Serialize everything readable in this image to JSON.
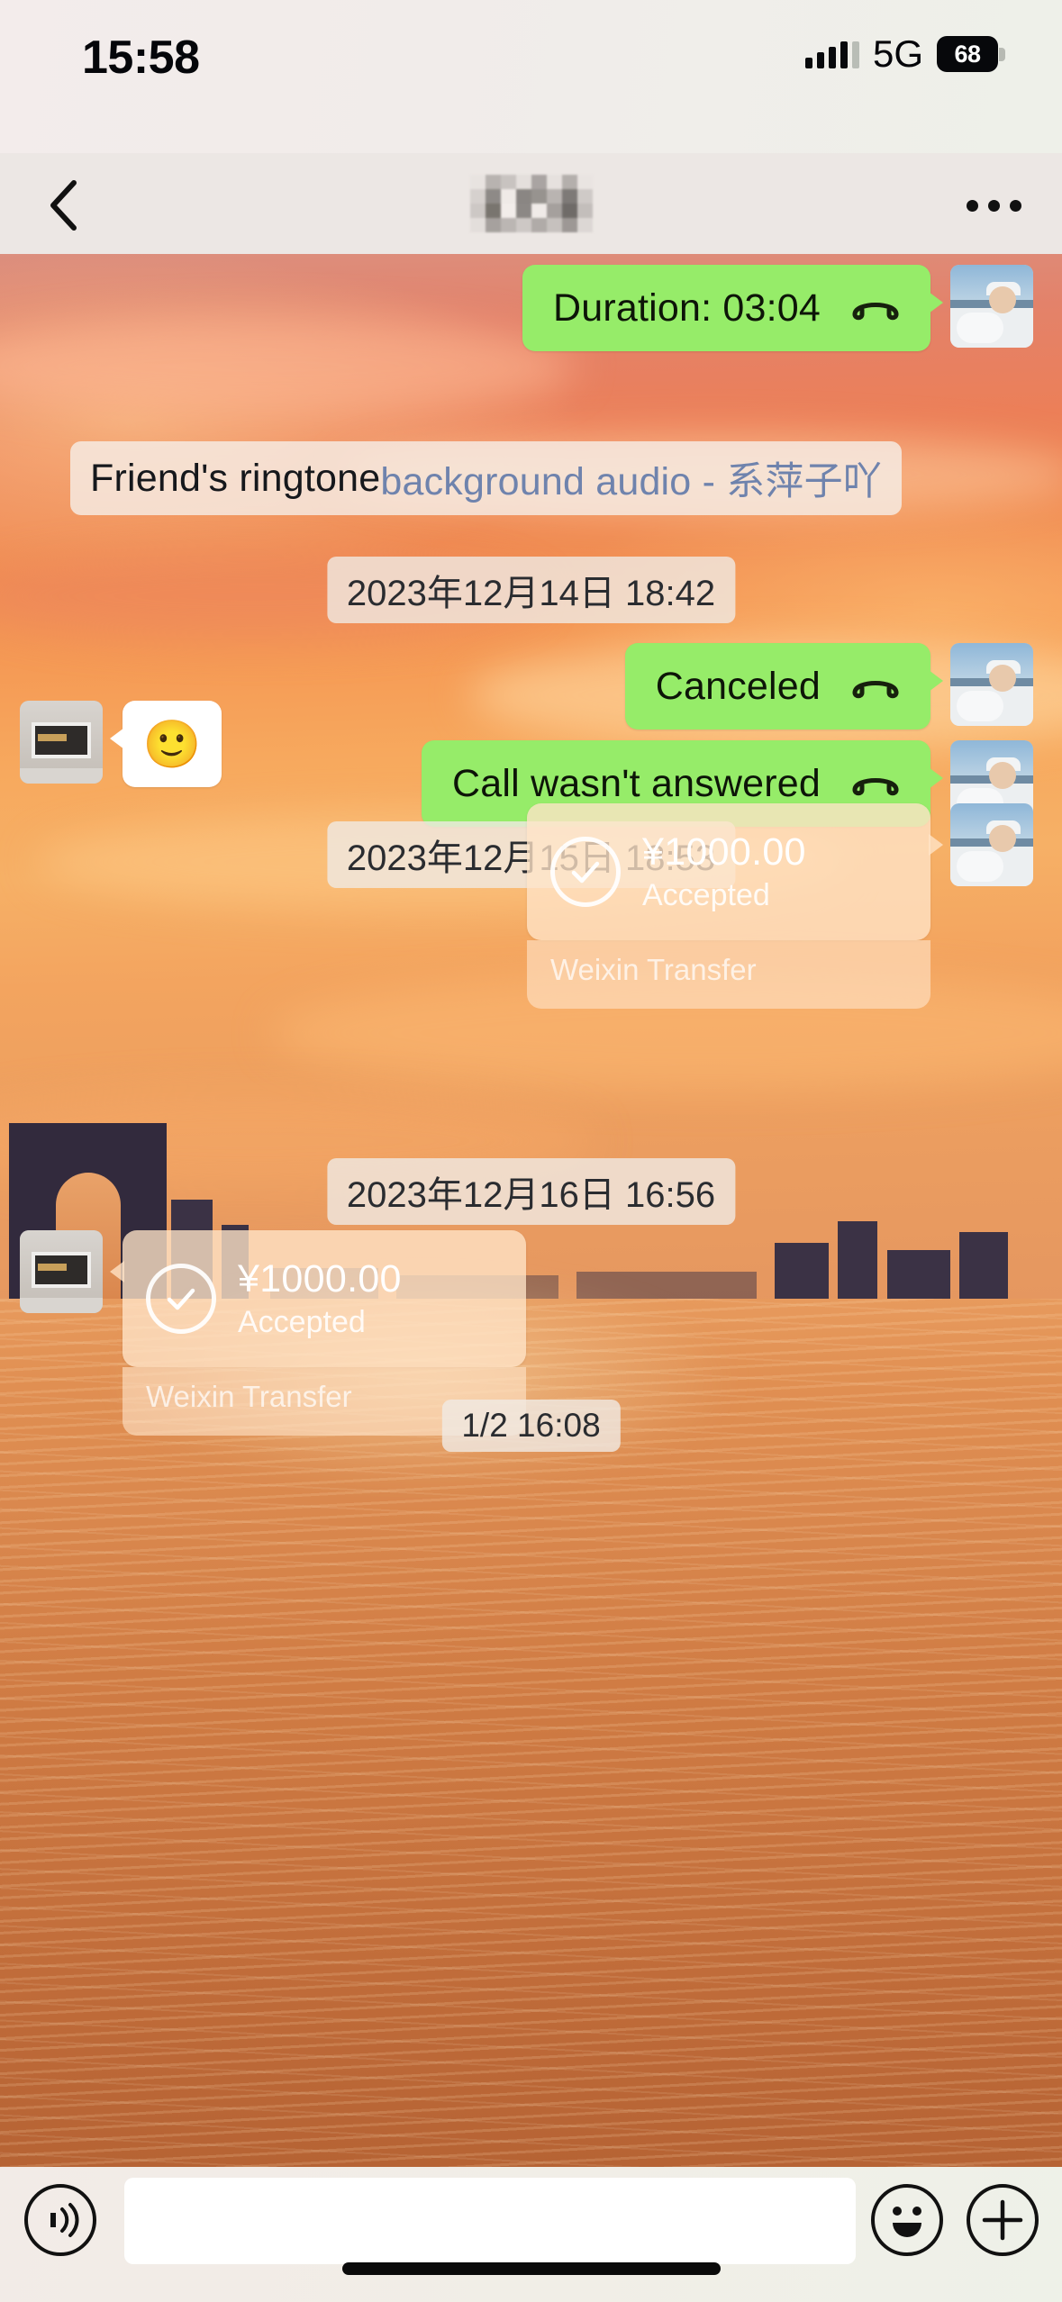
{
  "status_bar": {
    "time": "15:58",
    "network": "5G",
    "battery": "68",
    "signal_icon": "cellular-bars-icon",
    "battery_icon": "battery-icon"
  },
  "nav_bar": {
    "back_icon": "chevron-left-icon",
    "title": "",
    "title_state": "mosaic-redacted",
    "more_icon": "more-horizontal-icon"
  },
  "messages": [
    {
      "id": "call-duration",
      "side": "right",
      "type": "call-bubble",
      "text": "Duration: 03:04",
      "icon": "phone-handset-icon",
      "avatar": "contact-avatar"
    },
    {
      "id": "friend-ringtone",
      "side": "system",
      "type": "ringtone-notice",
      "prefix": "Friend's ringtone ",
      "link": "background audio - 系萍子吖"
    },
    {
      "id": "ts-1",
      "type": "timestamp",
      "text": "2023年12月14日 18:42"
    },
    {
      "id": "call-canceled",
      "side": "right",
      "type": "call-bubble",
      "text": "Canceled",
      "icon": "phone-handset-icon",
      "avatar": "contact-avatar"
    },
    {
      "id": "call-unanswered",
      "side": "right",
      "type": "call-bubble",
      "text": "Call wasn't answered",
      "icon": "phone-handset-icon",
      "avatar": "contact-avatar"
    },
    {
      "id": "ts-2",
      "type": "timestamp",
      "text": "2023年12月15日 18:53"
    },
    {
      "id": "emoji-msg",
      "side": "left",
      "type": "emoji-bubble",
      "emoji": "🙂",
      "avatar": "self-avatar"
    },
    {
      "id": "transfer-1",
      "side": "right",
      "type": "transfer-card",
      "amount": "¥1000.00",
      "status": "Accepted",
      "footer": "Weixin Transfer",
      "icon": "check-circle-icon",
      "avatar": "contact-avatar"
    },
    {
      "id": "ts-3",
      "type": "timestamp",
      "text": "2023年12月16日 16:56"
    },
    {
      "id": "transfer-2",
      "side": "left",
      "type": "transfer-card",
      "amount": "¥1000.00",
      "status": "Accepted",
      "footer": "Weixin Transfer",
      "icon": "check-circle-icon",
      "avatar": "self-avatar"
    },
    {
      "id": "ts-4",
      "type": "timestamp",
      "text": "1/2 16:08"
    }
  ],
  "input_bar": {
    "voice_icon": "voice-wave-icon",
    "text_value": "",
    "text_placeholder": "",
    "emoji_icon": "smiley-face-icon",
    "plus_icon": "plus-circle-icon"
  },
  "colors": {
    "bubble_green": "#96EC69",
    "link_blue": "#6F83AD",
    "transfer_card": "#FFE4C8",
    "nav_background": "#ECE7E4"
  }
}
